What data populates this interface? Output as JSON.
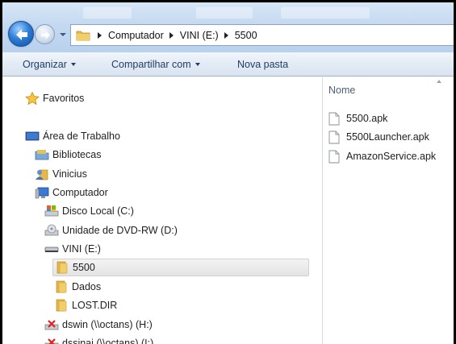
{
  "address": {
    "breadcrumbs": [
      "Computador",
      "VINI (E:)",
      "5500"
    ]
  },
  "toolbar": {
    "organize": "Organizar",
    "share": "Compartilhar com",
    "new_folder": "Nova pasta"
  },
  "navigation": {
    "favorites": "Favoritos",
    "desktop": "Área de Trabalho",
    "libraries": "Bibliotecas",
    "user": "Vinicius",
    "computer": "Computador",
    "drive_c": "Disco Local (C:)",
    "drive_d": "Unidade de DVD-RW (D:)",
    "drive_e": "VINI (E:)",
    "folders": [
      "5500",
      "Dados",
      "LOST.DIR"
    ],
    "net_h": "dswin (\\\\octans) (H:)",
    "net_i": "dssinai (\\\\octans) (I:)"
  },
  "content": {
    "column_name": "Nome",
    "files": [
      "5500.apk",
      "5500Launcher.apk",
      "AmazonService.apk"
    ]
  },
  "colors": {
    "accent": "#1e3e68",
    "folder": "#e7b94a",
    "selection": "#e6e6e6"
  }
}
